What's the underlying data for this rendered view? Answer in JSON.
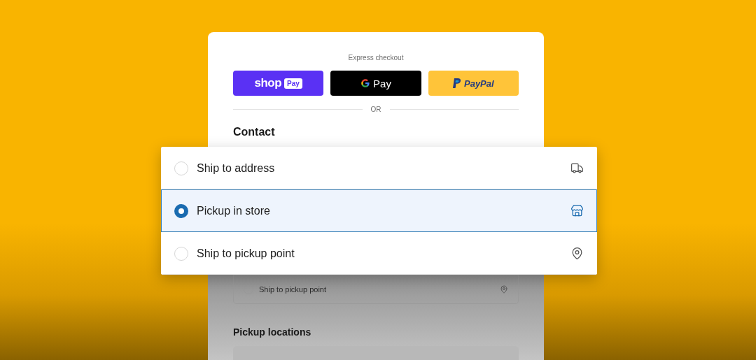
{
  "express_checkout": {
    "label": "Express checkout",
    "buttons": [
      {
        "kind": "shop",
        "text": "shop",
        "badge": "Pay"
      },
      {
        "kind": "gpay",
        "text": "Pay"
      },
      {
        "kind": "paypal",
        "text": "PayPal"
      }
    ]
  },
  "divider": "OR",
  "contact": {
    "title": "Contact"
  },
  "delivery_options": [
    {
      "label": "Ship to address",
      "kind": "truck",
      "selected": false
    },
    {
      "label": "Pickup in store",
      "kind": "store",
      "selected": true
    },
    {
      "label": "Ship to pickup point",
      "kind": "pin",
      "selected": false
    }
  ],
  "background_list": [
    {
      "label": "Ship to pickup point",
      "kind": "pin",
      "selected": false
    }
  ],
  "pickup_locations": {
    "title": "Pickup locations"
  }
}
